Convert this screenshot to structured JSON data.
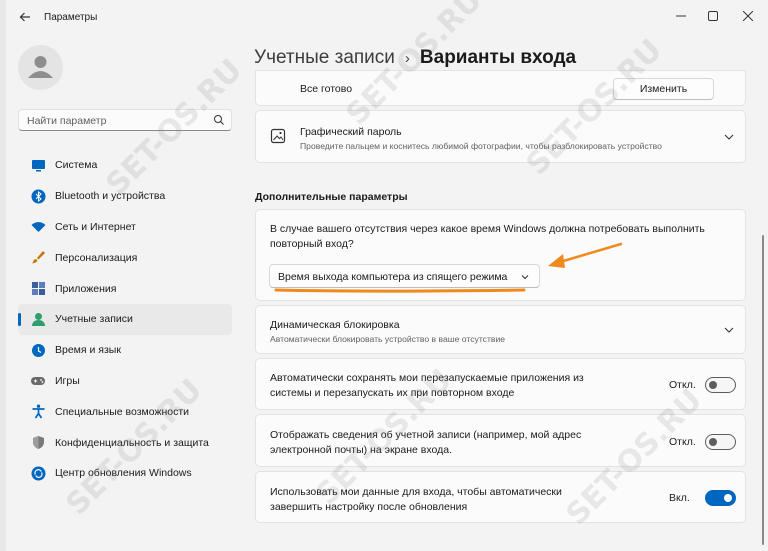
{
  "window": {
    "title": "Параметры"
  },
  "sidebar": {
    "search_placeholder": "Найти параметр",
    "items": [
      {
        "label": "Система",
        "icon": "monitor-icon",
        "color": "#0067c0"
      },
      {
        "label": "Bluetooth и устройства",
        "icon": "bluetooth-icon",
        "color": "#0067c0"
      },
      {
        "label": "Сеть и Интернет",
        "icon": "wifi-icon",
        "color": "#0067c0"
      },
      {
        "label": "Персонализация",
        "icon": "brush-icon",
        "color": "#c77700"
      },
      {
        "label": "Приложения",
        "icon": "apps-icon",
        "color": "#3a5d9c"
      },
      {
        "label": "Учетные записи",
        "icon": "person-icon",
        "color": "#2f9e6e"
      },
      {
        "label": "Время и язык",
        "icon": "globe-clock-icon",
        "color": "#0067c0"
      },
      {
        "label": "Игры",
        "icon": "gamepad-icon",
        "color": "#6b6b6b"
      },
      {
        "label": "Специальные возможности",
        "icon": "accessibility-icon",
        "color": "#0067c0"
      },
      {
        "label": "Конфиденциальность и защита",
        "icon": "shield-icon",
        "color": "#7a7a7a"
      },
      {
        "label": "Центр обновления Windows",
        "icon": "update-icon",
        "color": "#0067c0"
      }
    ],
    "active_index": 5
  },
  "breadcrumb": {
    "parent": "Учетные записи",
    "separator": "›",
    "current": "Варианты входа"
  },
  "ready_card": {
    "text": "Все готово",
    "button": "Изменить"
  },
  "picture_password": {
    "title": "Графический пароль",
    "subtitle": "Проведите пальцем и коснитесь любимой фотографии, чтобы разблокировать устройство"
  },
  "additional": {
    "section_title": "Дополнительные параметры",
    "signin_question": "В случае вашего отсутствия через какое время Windows должна потребовать выполнить повторный вход?",
    "dropdown_value": "Время выхода компьютера из спящего режима"
  },
  "dynamic_lock": {
    "title": "Динамическая блокировка",
    "subtitle": "Автоматически блокировать устройство в ваше отсутствие"
  },
  "toggles": [
    {
      "label": "Автоматически сохранять мои перезапускаемые приложения из системы и перезапускать их при повторном входе",
      "state_text": "Откл.",
      "on": false
    },
    {
      "label": "Отображать сведения об учетной записи (например, мой адрес электронной почты) на экране входа.",
      "state_text": "Откл.",
      "on": false
    },
    {
      "label": "Использовать мои данные для входа, чтобы автоматически завершить настройку после обновления",
      "state_text": "Вкл.",
      "on": true
    }
  ],
  "annotation_color": "#f08a1c",
  "watermark": "SET-OS.RU"
}
